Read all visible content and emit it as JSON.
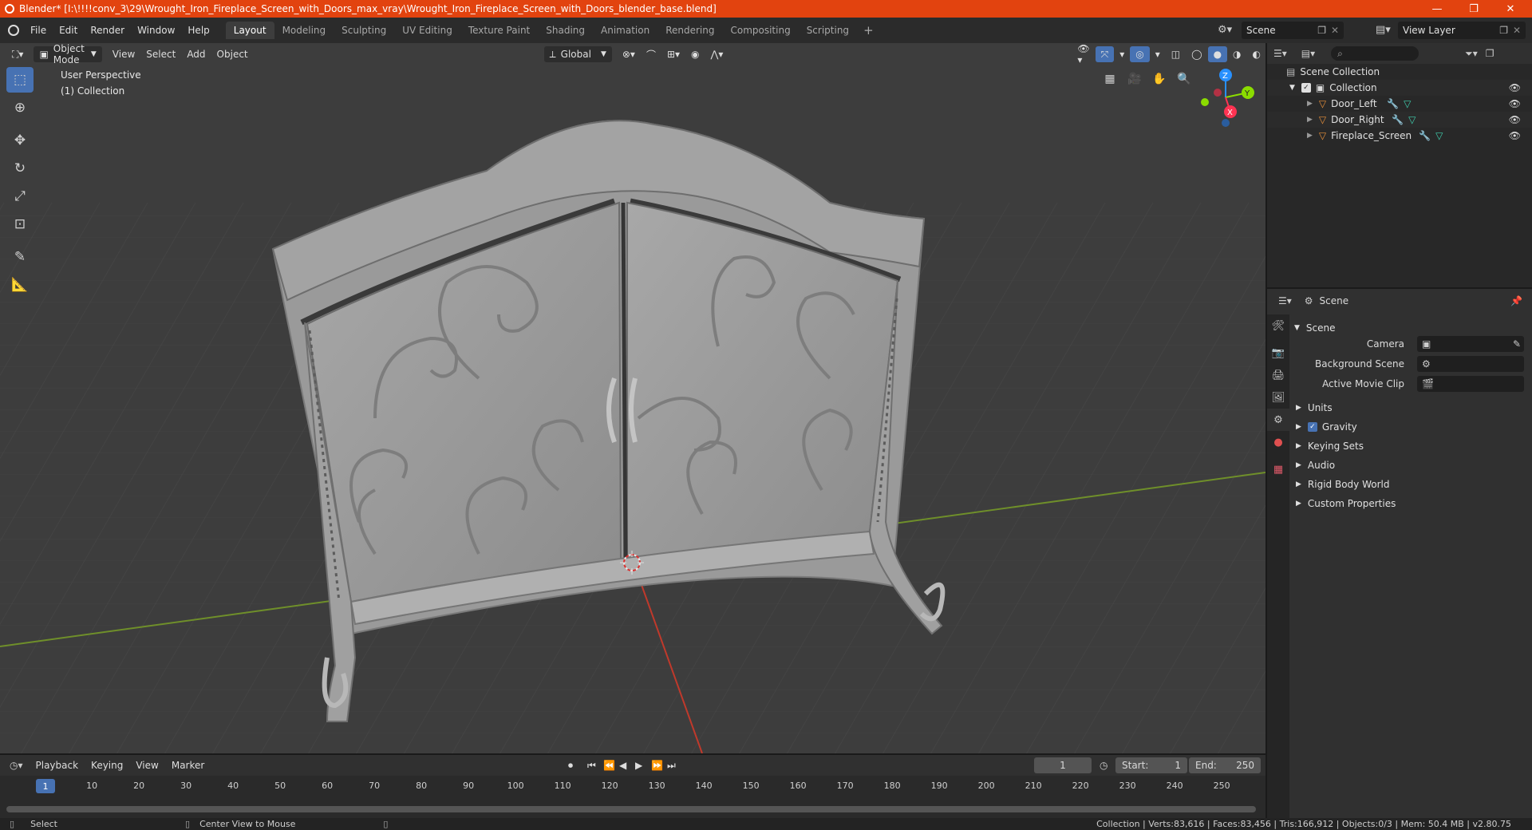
{
  "window": {
    "title": "Blender* [I:\\!!!!conv_3\\29\\Wrought_Iron_Fireplace_Screen_with_Doors_max_vray\\Wrought_Iron_Fireplace_Screen_with_Doors_blender_base.blend]",
    "minimize": "—",
    "maximize": "❐",
    "close": "✕"
  },
  "menu": {
    "items": [
      "File",
      "Edit",
      "Render",
      "Window",
      "Help"
    ]
  },
  "workspaces": {
    "tabs": [
      "Layout",
      "Modeling",
      "Sculpting",
      "UV Editing",
      "Texture Paint",
      "Shading",
      "Animation",
      "Rendering",
      "Compositing",
      "Scripting"
    ],
    "active": "Layout",
    "add": "+"
  },
  "scene_field": "Scene",
  "view_layer_field": "View Layer",
  "viewport": {
    "mode": "Object Mode",
    "menus": [
      "View",
      "Select",
      "Add",
      "Object"
    ],
    "orientation": "Global",
    "perspective_label": "User Perspective",
    "collection_label": "(1) Collection",
    "gizmo": {
      "x": "X",
      "y": "Y",
      "z": "Z"
    }
  },
  "outliner": {
    "root": "Scene Collection",
    "collection": "Collection",
    "objects": [
      "Door_Left",
      "Door_Right",
      "Fireplace_Screen"
    ],
    "search_placeholder": ""
  },
  "properties": {
    "header": "Scene",
    "section": "Scene",
    "camera_label": "Camera",
    "background_scene_label": "Background Scene",
    "active_movie_clip_label": "Active Movie Clip",
    "subsections": [
      "Units",
      "Gravity",
      "Keying Sets",
      "Audio",
      "Rigid Body World",
      "Custom Properties"
    ],
    "gravity_checked": true
  },
  "timeline": {
    "menus": [
      "Playback",
      "Keying",
      "View",
      "Marker"
    ],
    "current_frame": "1",
    "start_label": "Start:",
    "start": "1",
    "end_label": "End:",
    "end": "250",
    "ticks": [
      "10",
      "20",
      "30",
      "40",
      "50",
      "60",
      "70",
      "80",
      "90",
      "100",
      "110",
      "120",
      "130",
      "140",
      "150",
      "160",
      "170",
      "180",
      "190",
      "200",
      "210",
      "220",
      "230",
      "240",
      "250"
    ],
    "playhead": "1"
  },
  "statusbar": {
    "select": "Select",
    "center_view": "Center View to Mouse",
    "stats": "Collection | Verts:83,616 | Faces:83,456 | Tris:166,912 | Objects:0/3 | Mem: 50.4 MB | v2.80.75"
  },
  "colors": {
    "title_bar": "#e2430f",
    "accent": "#4772b3",
    "x_axis": "#ff3352",
    "y_axis": "#8bdc00",
    "z_axis": "#2890ff",
    "object_icon": "#e8903a"
  }
}
